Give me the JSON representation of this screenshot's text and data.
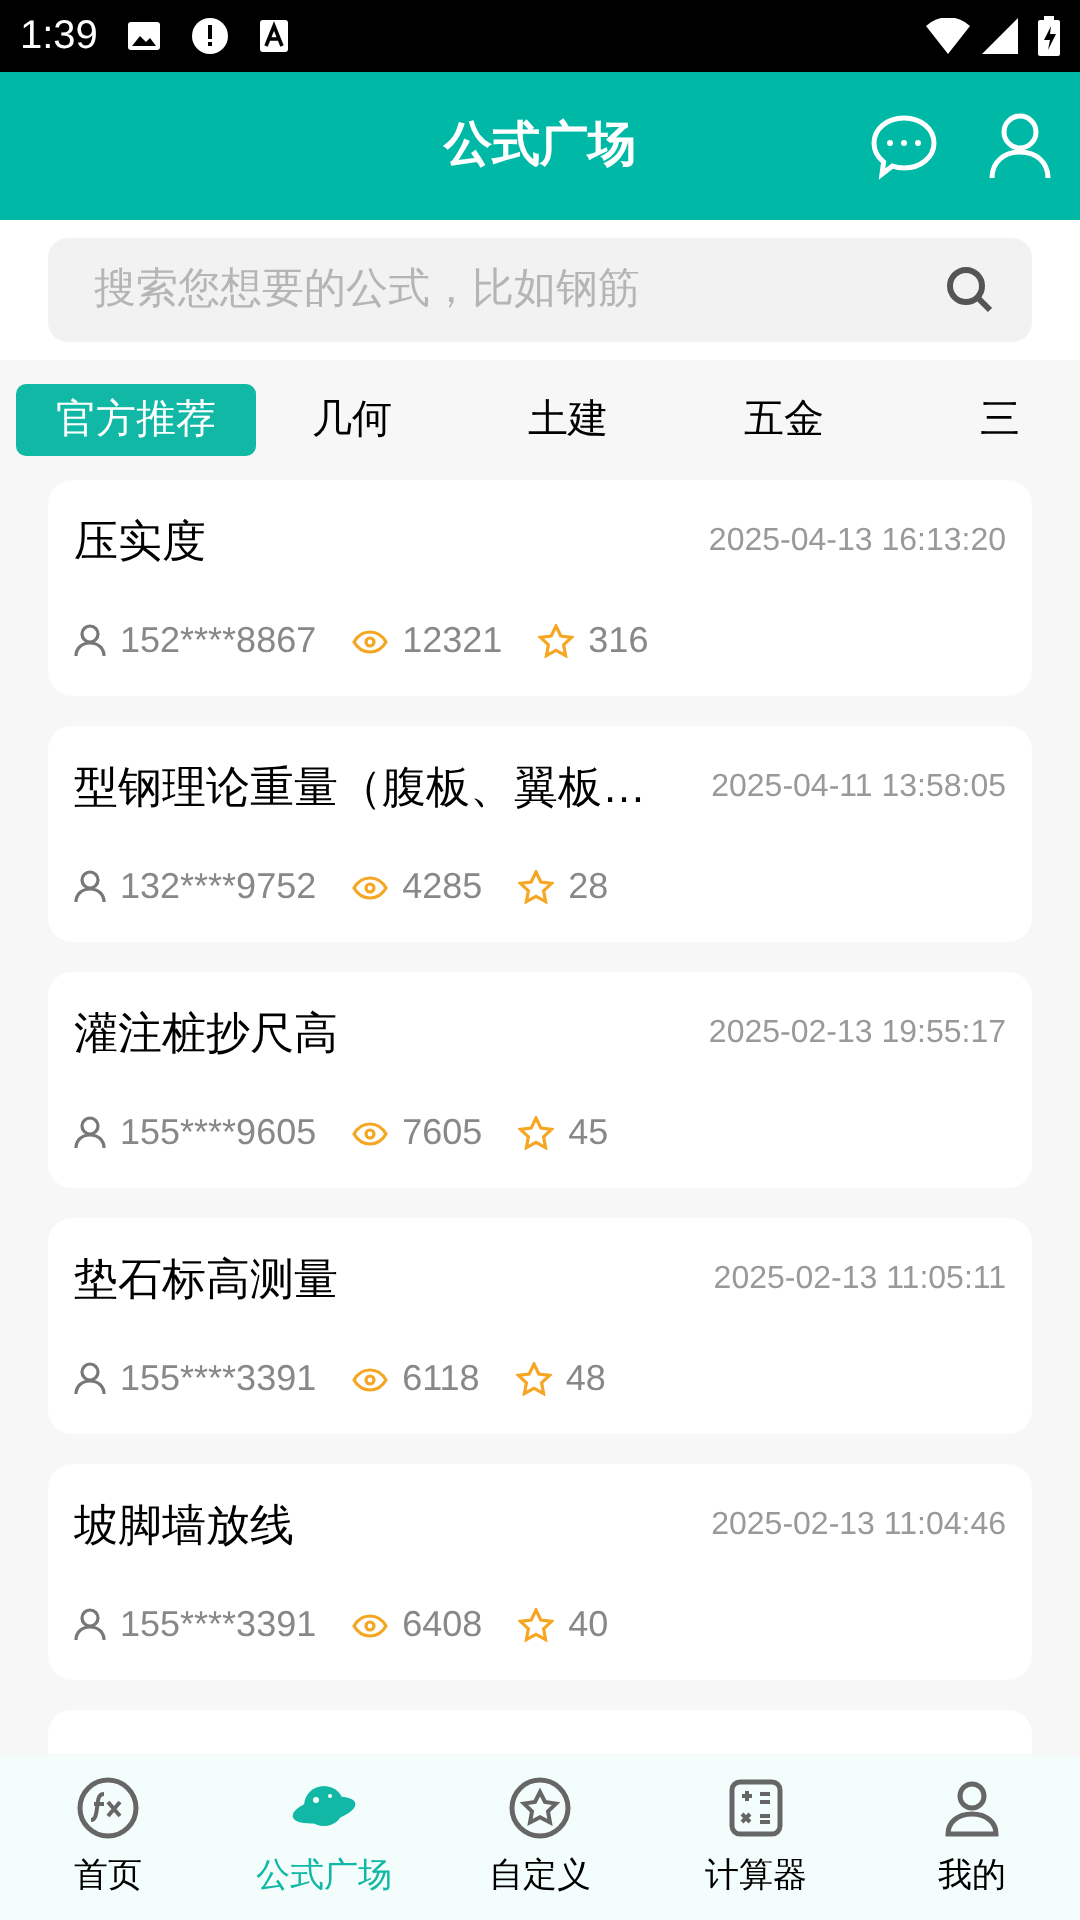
{
  "status_bar": {
    "time": "1:39"
  },
  "header": {
    "title": "公式广场"
  },
  "search": {
    "placeholder": "搜索您想要的公式，比如钢筋"
  },
  "tabs": [
    {
      "label": "官方推荐",
      "selected": true
    },
    {
      "label": "几何",
      "selected": false
    },
    {
      "label": "土建",
      "selected": false
    },
    {
      "label": "五金",
      "selected": false
    },
    {
      "label": "三",
      "selected": false
    }
  ],
  "formulas": [
    {
      "title": "压实度",
      "time": "2025-04-13 16:13:20",
      "author": "152****8867",
      "views": "12321",
      "stars_count": "316"
    },
    {
      "title": "型钢理论重量（腹板、翼板…",
      "time": "2025-04-11 13:58:05",
      "author": "132****9752",
      "views": "4285",
      "stars_count": "28"
    },
    {
      "title": "灌注桩抄尺高",
      "time": "2025-02-13 19:55:17",
      "author": "155****9605",
      "views": "7605",
      "stars_count": "45"
    },
    {
      "title": "垫石标高测量",
      "time": "2025-02-13 11:05:11",
      "author": "155****3391",
      "views": "6118",
      "stars_count": "48"
    },
    {
      "title": "坡脚墙放线",
      "time": "2025-02-13 11:04:46",
      "author": "155****3391",
      "views": "6408",
      "stars_count": "40"
    }
  ],
  "bottom_nav": [
    {
      "label": "首页",
      "kind": "fx",
      "selected": false
    },
    {
      "label": "公式广场",
      "kind": "planet",
      "selected": true
    },
    {
      "label": "自定义",
      "kind": "star",
      "selected": false
    },
    {
      "label": "计算器",
      "kind": "calc",
      "selected": false
    },
    {
      "label": "我的",
      "kind": "user",
      "selected": false
    }
  ]
}
